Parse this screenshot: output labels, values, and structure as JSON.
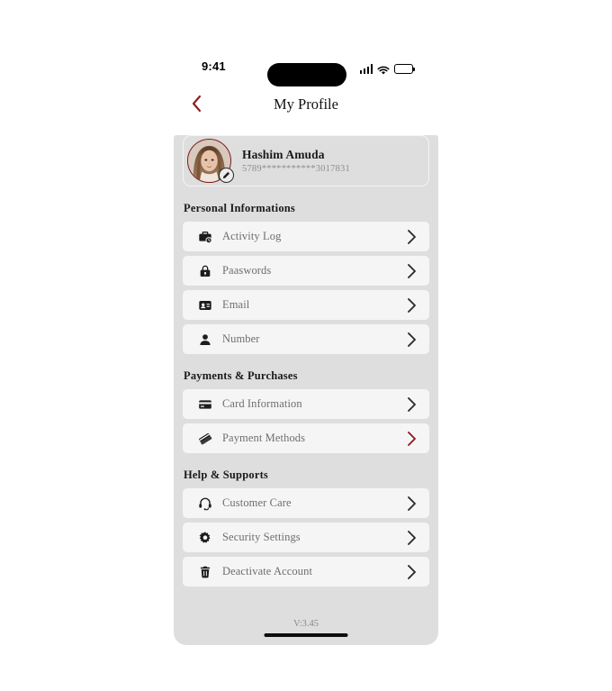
{
  "status_bar": {
    "time": "9:41",
    "signal_icon": "cellular-signal-icon",
    "wifi_icon": "wifi-icon",
    "battery_icon": "battery-full-icon"
  },
  "nav": {
    "back_icon": "chevron-left-icon",
    "title": "My Profile"
  },
  "profile": {
    "name": "Hashim Amuda",
    "card_number": "5789***********3017831",
    "avatar_icon": "user-avatar-photo",
    "edit_icon": "edit-pencil-icon"
  },
  "sections": [
    {
      "title": "Personal Informations",
      "items": [
        {
          "label": "Activity Log",
          "icon": "briefcase-clock-icon",
          "chevron_color": "#2b2b2b"
        },
        {
          "label": "Paaswords",
          "icon": "lock-icon",
          "chevron_color": "#2b2b2b"
        },
        {
          "label": "Email",
          "icon": "id-card-icon",
          "chevron_color": "#2b2b2b"
        },
        {
          "label": "Number",
          "icon": "person-icon",
          "chevron_color": "#2b2b2b"
        }
      ]
    },
    {
      "title": "Payments & Purchases",
      "items": [
        {
          "label": "Card Information",
          "icon": "credit-card-icon",
          "chevron_color": "#2b2b2b"
        },
        {
          "label": "Payment Methods",
          "icon": "payment-cards-stack-icon",
          "chevron_color": "#8b1c20"
        }
      ]
    },
    {
      "title": "Help & Supports",
      "items": [
        {
          "label": "Customer Care",
          "icon": "headset-icon",
          "chevron_color": "#2b2b2b"
        },
        {
          "label": "Security Settings",
          "icon": "gear-icon",
          "chevron_color": "#2b2b2b"
        },
        {
          "label": "Deactivate Account",
          "icon": "trash-icon",
          "chevron_color": "#2b2b2b"
        }
      ]
    }
  ],
  "footer": {
    "version": "V:3.45",
    "home_indicator": "home-indicator-bar"
  },
  "colors": {
    "accent": "#8b1c20",
    "panel_bg": "#dedede",
    "row_bg": "#f5f5f5",
    "label_text": "#6e6e6e",
    "heading_text": "#1a1a1a"
  }
}
